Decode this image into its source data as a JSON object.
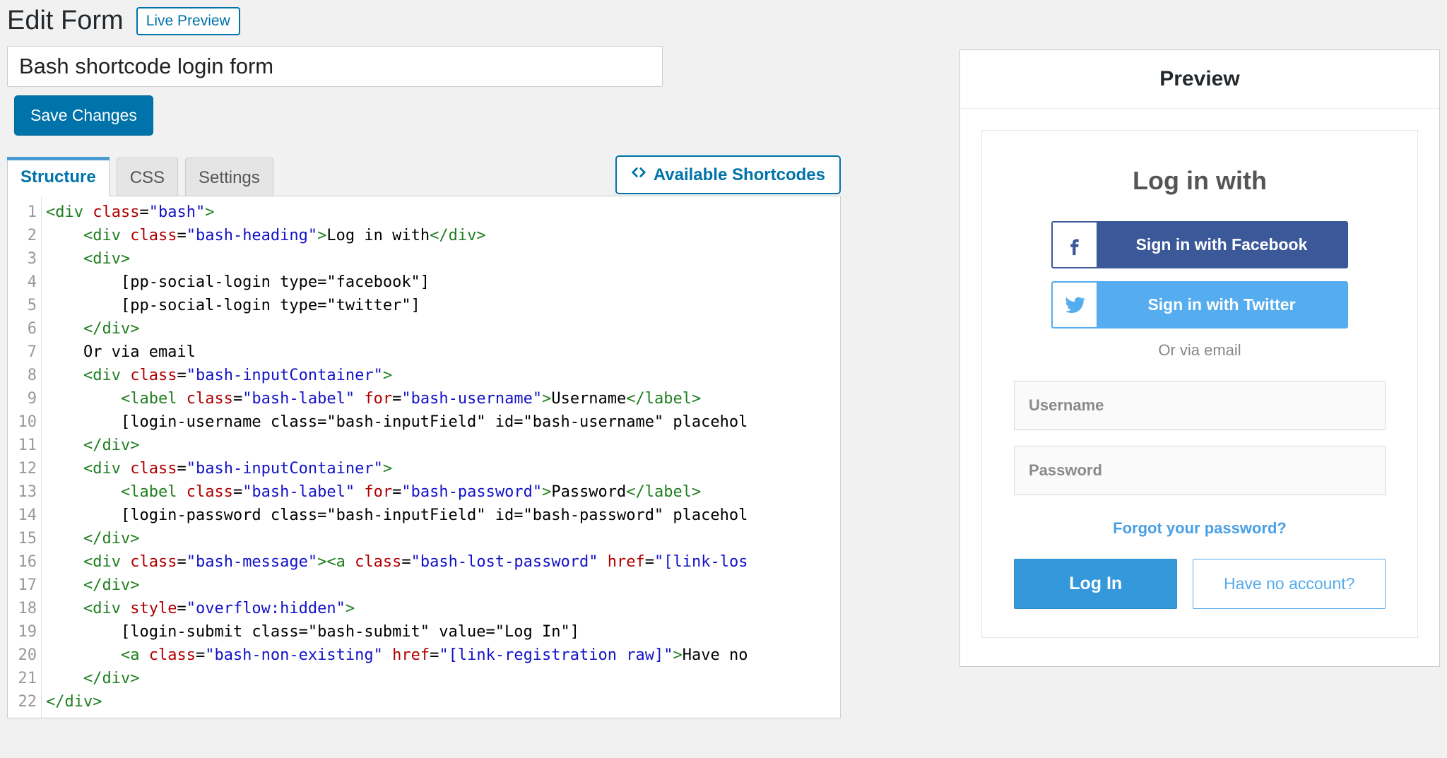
{
  "header": {
    "title": "Edit Form",
    "live_preview": "Live Preview"
  },
  "form": {
    "title_value": "Bash shortcode login form",
    "save_label": "Save Changes"
  },
  "tabs": {
    "structure": "Structure",
    "css": "CSS",
    "settings": "Settings",
    "available_shortcodes": "Available Shortcodes"
  },
  "code_lines": [
    [
      [
        "punct",
        "<"
      ],
      [
        "tag",
        "div"
      ],
      [
        "txt",
        " "
      ],
      [
        "attr",
        "class"
      ],
      [
        "txt",
        "="
      ],
      [
        "val",
        "\"bash\""
      ],
      [
        "punct",
        ">"
      ]
    ],
    [
      [
        "txt",
        "    "
      ],
      [
        "punct",
        "<"
      ],
      [
        "tag",
        "div"
      ],
      [
        "txt",
        " "
      ],
      [
        "attr",
        "class"
      ],
      [
        "txt",
        "="
      ],
      [
        "val",
        "\"bash-heading\""
      ],
      [
        "punct",
        ">"
      ],
      [
        "txt",
        "Log in with"
      ],
      [
        "punct",
        "</"
      ],
      [
        "tag",
        "div"
      ],
      [
        "punct",
        ">"
      ]
    ],
    [
      [
        "txt",
        "    "
      ],
      [
        "punct",
        "<"
      ],
      [
        "tag",
        "div"
      ],
      [
        "punct",
        ">"
      ]
    ],
    [
      [
        "txt",
        "        [pp-social-login type=\"facebook\"]"
      ]
    ],
    [
      [
        "txt",
        "        [pp-social-login type=\"twitter\"]"
      ]
    ],
    [
      [
        "txt",
        "    "
      ],
      [
        "punct",
        "</"
      ],
      [
        "tag",
        "div"
      ],
      [
        "punct",
        ">"
      ]
    ],
    [
      [
        "txt",
        "    Or via email"
      ]
    ],
    [
      [
        "txt",
        "    "
      ],
      [
        "punct",
        "<"
      ],
      [
        "tag",
        "div"
      ],
      [
        "txt",
        " "
      ],
      [
        "attr",
        "class"
      ],
      [
        "txt",
        "="
      ],
      [
        "val",
        "\"bash-inputContainer\""
      ],
      [
        "punct",
        ">"
      ]
    ],
    [
      [
        "txt",
        "        "
      ],
      [
        "punct",
        "<"
      ],
      [
        "tag",
        "label"
      ],
      [
        "txt",
        " "
      ],
      [
        "attr",
        "class"
      ],
      [
        "txt",
        "="
      ],
      [
        "val",
        "\"bash-label\""
      ],
      [
        "txt",
        " "
      ],
      [
        "attr",
        "for"
      ],
      [
        "txt",
        "="
      ],
      [
        "val",
        "\"bash-username\""
      ],
      [
        "punct",
        ">"
      ],
      [
        "txt",
        "Username"
      ],
      [
        "punct",
        "</"
      ],
      [
        "tag",
        "label"
      ],
      [
        "punct",
        ">"
      ]
    ],
    [
      [
        "txt",
        "        [login-username class=\"bash-inputField\" id=\"bash-username\" placehol"
      ]
    ],
    [
      [
        "txt",
        "    "
      ],
      [
        "punct",
        "</"
      ],
      [
        "tag",
        "div"
      ],
      [
        "punct",
        ">"
      ]
    ],
    [
      [
        "txt",
        "    "
      ],
      [
        "punct",
        "<"
      ],
      [
        "tag",
        "div"
      ],
      [
        "txt",
        " "
      ],
      [
        "attr",
        "class"
      ],
      [
        "txt",
        "="
      ],
      [
        "val",
        "\"bash-inputContainer\""
      ],
      [
        "punct",
        ">"
      ]
    ],
    [
      [
        "txt",
        "        "
      ],
      [
        "punct",
        "<"
      ],
      [
        "tag",
        "label"
      ],
      [
        "txt",
        " "
      ],
      [
        "attr",
        "class"
      ],
      [
        "txt",
        "="
      ],
      [
        "val",
        "\"bash-label\""
      ],
      [
        "txt",
        " "
      ],
      [
        "attr",
        "for"
      ],
      [
        "txt",
        "="
      ],
      [
        "val",
        "\"bash-password\""
      ],
      [
        "punct",
        ">"
      ],
      [
        "txt",
        "Password"
      ],
      [
        "punct",
        "</"
      ],
      [
        "tag",
        "label"
      ],
      [
        "punct",
        ">"
      ]
    ],
    [
      [
        "txt",
        "        [login-password class=\"bash-inputField\" id=\"bash-password\" placehol"
      ]
    ],
    [
      [
        "txt",
        "    "
      ],
      [
        "punct",
        "</"
      ],
      [
        "tag",
        "div"
      ],
      [
        "punct",
        ">"
      ]
    ],
    [
      [
        "txt",
        "    "
      ],
      [
        "punct",
        "<"
      ],
      [
        "tag",
        "div"
      ],
      [
        "txt",
        " "
      ],
      [
        "attr",
        "class"
      ],
      [
        "txt",
        "="
      ],
      [
        "val",
        "\"bash-message\""
      ],
      [
        "punct",
        ">"
      ],
      [
        "punct",
        "<"
      ],
      [
        "tag",
        "a"
      ],
      [
        "txt",
        " "
      ],
      [
        "attr",
        "class"
      ],
      [
        "txt",
        "="
      ],
      [
        "val",
        "\"bash-lost-password\""
      ],
      [
        "txt",
        " "
      ],
      [
        "attr",
        "href"
      ],
      [
        "txt",
        "="
      ],
      [
        "val",
        "\"[link-los"
      ]
    ],
    [
      [
        "txt",
        "    "
      ],
      [
        "punct",
        "</"
      ],
      [
        "tag",
        "div"
      ],
      [
        "punct",
        ">"
      ]
    ],
    [
      [
        "txt",
        "    "
      ],
      [
        "punct",
        "<"
      ],
      [
        "tag",
        "div"
      ],
      [
        "txt",
        " "
      ],
      [
        "attr",
        "style"
      ],
      [
        "txt",
        "="
      ],
      [
        "val",
        "\"overflow:hidden\""
      ],
      [
        "punct",
        ">"
      ]
    ],
    [
      [
        "txt",
        "        [login-submit class=\"bash-submit\" value=\"Log In\"]"
      ]
    ],
    [
      [
        "txt",
        "        "
      ],
      [
        "punct",
        "<"
      ],
      [
        "tag",
        "a"
      ],
      [
        "txt",
        " "
      ],
      [
        "attr",
        "class"
      ],
      [
        "txt",
        "="
      ],
      [
        "val",
        "\"bash-non-existing\""
      ],
      [
        "txt",
        " "
      ],
      [
        "attr",
        "href"
      ],
      [
        "txt",
        "="
      ],
      [
        "val",
        "\"[link-registration raw]\""
      ],
      [
        "punct",
        ">"
      ],
      [
        "txt",
        "Have no"
      ]
    ],
    [
      [
        "txt",
        "    "
      ],
      [
        "punct",
        "</"
      ],
      [
        "tag",
        "div"
      ],
      [
        "punct",
        ">"
      ]
    ],
    [
      [
        "punct",
        "</"
      ],
      [
        "tag",
        "div"
      ],
      [
        "punct",
        ">"
      ]
    ]
  ],
  "preview": {
    "panel_title": "Preview",
    "heading": "Log in with",
    "facebook_label": "Sign in with Facebook",
    "twitter_label": "Sign in with Twitter",
    "or_via": "Or via email",
    "username_placeholder": "Username",
    "password_placeholder": "Password",
    "forgot": "Forgot your password?",
    "login_label": "Log In",
    "no_account_label": "Have no account?"
  }
}
